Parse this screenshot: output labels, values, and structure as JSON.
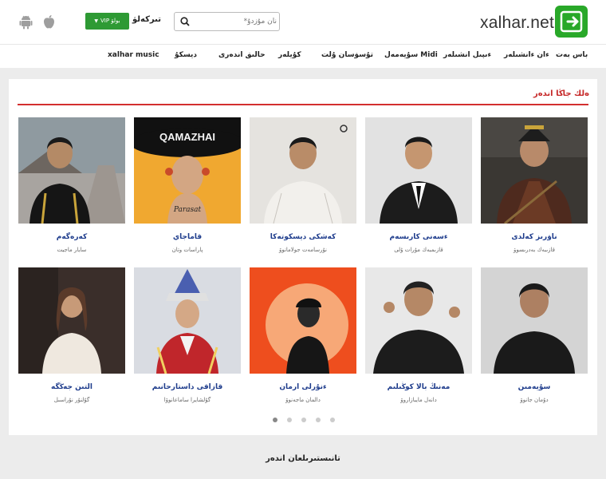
{
  "header": {
    "logo_text": "xalhar.net",
    "search_placeholder": "نان مۇزدۇ*",
    "login_label": "تىركەلۋ",
    "vip_label": "VIP بولۋ",
    "apple_icon": "apple-icon",
    "android_icon": "android-icon",
    "brand_color": "#29a829"
  },
  "nav": {
    "items": [
      "باس بەت",
      "ءان ءانشىلەر",
      "ءىپىل انشىلەر",
      "سۇيەمەل Midi",
      "تۇسۋسان ۇلت",
      "كۇيلەر",
      "حالىق اندەرى",
      "ديسكۇ",
      "xalhar music"
    ]
  },
  "section": {
    "title": "ەلك جاڭا اندەر",
    "accent_color": "#d32f2f"
  },
  "cards": [
    {
      "name": "ناۋرىز كەلدى",
      "artist": "قازىبەك بەدرىسوۋ"
    },
    {
      "name": "ءسەنى كارىسەم",
      "artist": "قازىمبەك مۇرات ۇلى"
    },
    {
      "name": "كەشكى ديسكوتەكا",
      "artist": "نۇرسامەت جولامانوۆ"
    },
    {
      "name": "قاماجاي",
      "artist": "پاراسات وتان"
    },
    {
      "name": "كەرەگەم",
      "artist": "سايار ماجيت"
    },
    {
      "name": "سۇيەمىن",
      "artist": "دۇمان جانوۆ"
    },
    {
      "name": "مەنىڭ بالا كوڭىلىم",
      "artist": "دانەل مايبازاروۆ"
    },
    {
      "name": "ءنۇرلى ارمان",
      "artist": "دالمان ماجەنوۆ"
    },
    {
      "name": "قازاقى داستارحانىم",
      "artist": "گۇلشايرا ساماعانوۆا"
    },
    {
      "name": "التىن جەڭگە",
      "artist": "گۇلنۇر نۇراسىل"
    }
  ],
  "pagination": {
    "pages": 5,
    "active": 1
  },
  "footer": {
    "title": "تانىستىرىلعان اندەر"
  }
}
